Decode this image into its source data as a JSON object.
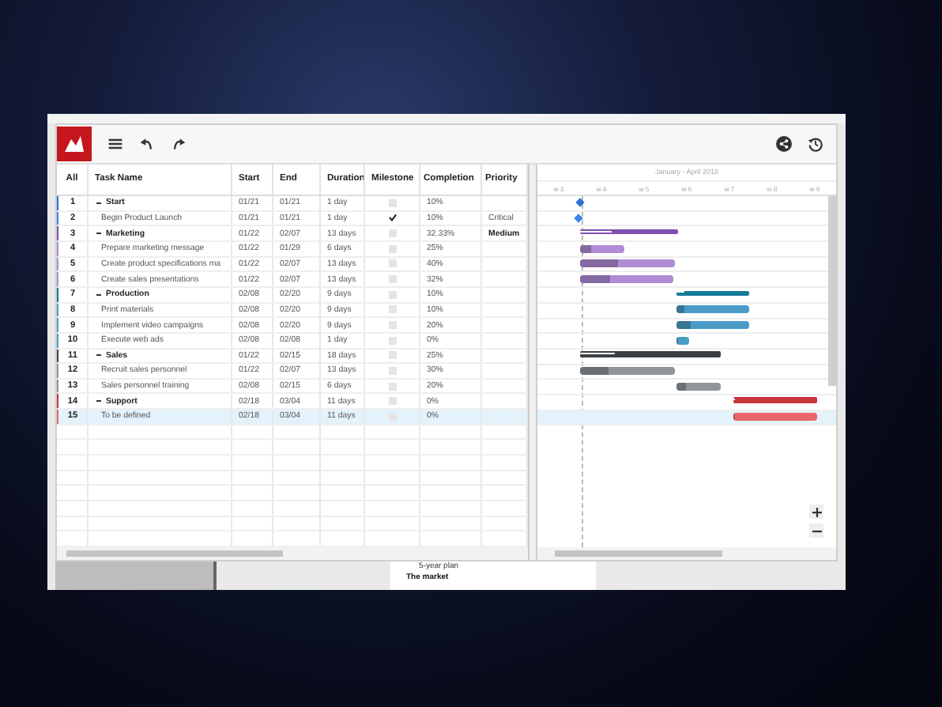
{
  "table": {
    "columns": [
      "All",
      "Task Name",
      "Start",
      "End",
      "Duration",
      "Milestone",
      "Completion",
      "Priority"
    ],
    "rows": [
      {
        "num": "1",
        "name": "Start",
        "kind": "group",
        "expanded": true,
        "start": "01/21",
        "end": "01/21",
        "duration": "1 day",
        "milestone": false,
        "completion": "10%",
        "color": "#2f6fd6",
        "selected": false
      },
      {
        "num": "2",
        "name": "Begin Product Launch",
        "kind": "task",
        "start": "01/21",
        "end": "01/21",
        "duration": "1 day",
        "milestone": true,
        "completion": "10%",
        "priority": "Critical",
        "color": "#3b82e8",
        "selected": false
      },
      {
        "num": "3",
        "name": "Marketing",
        "kind": "group",
        "expanded": true,
        "start": "01/22",
        "end": "02/07",
        "duration": "13 days",
        "milestone": false,
        "completion": "32.33%",
        "level": 0.3233,
        "priority": "Medium",
        "color": "#7f4fb0",
        "selected": false
      },
      {
        "num": "4",
        "name": "Prepare marketing message",
        "kind": "task",
        "start": "01/22",
        "end": "01/29",
        "duration": "6 days",
        "milestone": false,
        "completion": "25%",
        "level": 0.25,
        "color": "#b08bd6",
        "selected": false
      },
      {
        "num": "5",
        "name": "Create product specifications ma",
        "kind": "task",
        "start": "01/22",
        "end": "02/07",
        "duration": "13 days",
        "milestone": false,
        "completion": "40%",
        "level": 0.4,
        "color": "#b08bd6",
        "selected": false
      },
      {
        "num": "6",
        "name": "Create sales presentations",
        "kind": "task",
        "start": "01/22",
        "end": "02/07",
        "duration": "13 days",
        "milestone": false,
        "completion": "32%",
        "level": 0.32,
        "color": "#b08bd6",
        "selected": false
      },
      {
        "num": "7",
        "name": "Production",
        "kind": "group",
        "expanded": true,
        "start": "02/08",
        "end": "02/20",
        "duration": "9 days",
        "milestone": false,
        "completion": "10%",
        "level": 0.1,
        "color": "#157a99",
        "selected": false
      },
      {
        "num": "8",
        "name": "Print materials",
        "kind": "task",
        "start": "02/08",
        "end": "02/20",
        "duration": "9 days",
        "milestone": false,
        "completion": "10%",
        "level": 0.1,
        "color": "#4a9cc6",
        "selected": false
      },
      {
        "num": "9",
        "name": "Implement video campaigns",
        "kind": "task",
        "start": "02/08",
        "end": "02/20",
        "duration": "9 days",
        "milestone": false,
        "completion": "20%",
        "level": 0.2,
        "color": "#4a9cc6",
        "selected": false
      },
      {
        "num": "10",
        "name": "Execute web ads",
        "kind": "task",
        "start": "02/08",
        "end": "02/08",
        "duration": "1 day",
        "milestone": false,
        "completion": "0%",
        "level": 0,
        "color": "#4a9cc6",
        "selected": false
      },
      {
        "num": "11",
        "name": "Sales",
        "kind": "group",
        "expanded": true,
        "start": "01/22",
        "end": "02/15",
        "duration": "18 days",
        "milestone": false,
        "completion": "25%",
        "level": 0.25,
        "color": "#3a3f44",
        "selected": false
      },
      {
        "num": "12",
        "name": "Recruit sales personnel",
        "kind": "task",
        "start": "01/22",
        "end": "02/07",
        "duration": "13 days",
        "milestone": false,
        "completion": "30%",
        "level": 0.3,
        "color": "#8e969b",
        "selected": false
      },
      {
        "num": "13",
        "name": "Sales personnel training",
        "kind": "task",
        "start": "02/08",
        "end": "02/15",
        "duration": "6 days",
        "milestone": false,
        "completion": "20%",
        "level": 0.2,
        "color": "#8e969b",
        "selected": false
      },
      {
        "num": "14",
        "name": "Support",
        "kind": "group",
        "expanded": true,
        "start": "02/18",
        "end": "03/04",
        "duration": "11 days",
        "milestone": false,
        "completion": "0%",
        "level": 0,
        "color": "#c7353b",
        "selected": false
      },
      {
        "num": "15",
        "name": "To be defined",
        "kind": "task",
        "start": "02/18",
        "end": "03/04",
        "duration": "11 days",
        "milestone": false,
        "completion": "0%",
        "level": 0,
        "color": "#e8666a",
        "selected": true
      }
    ]
  },
  "timeline": {
    "title": "January - April 2018",
    "weeks": [
      "w 3",
      "w 4",
      "w 5",
      "w 6",
      "w 7",
      "w 8",
      "w 9"
    ]
  },
  "document": {
    "items": [
      {
        "text": "5-year plan",
        "kind": "sub"
      },
      {
        "text": "The market",
        "kind": "heading"
      }
    ]
  }
}
